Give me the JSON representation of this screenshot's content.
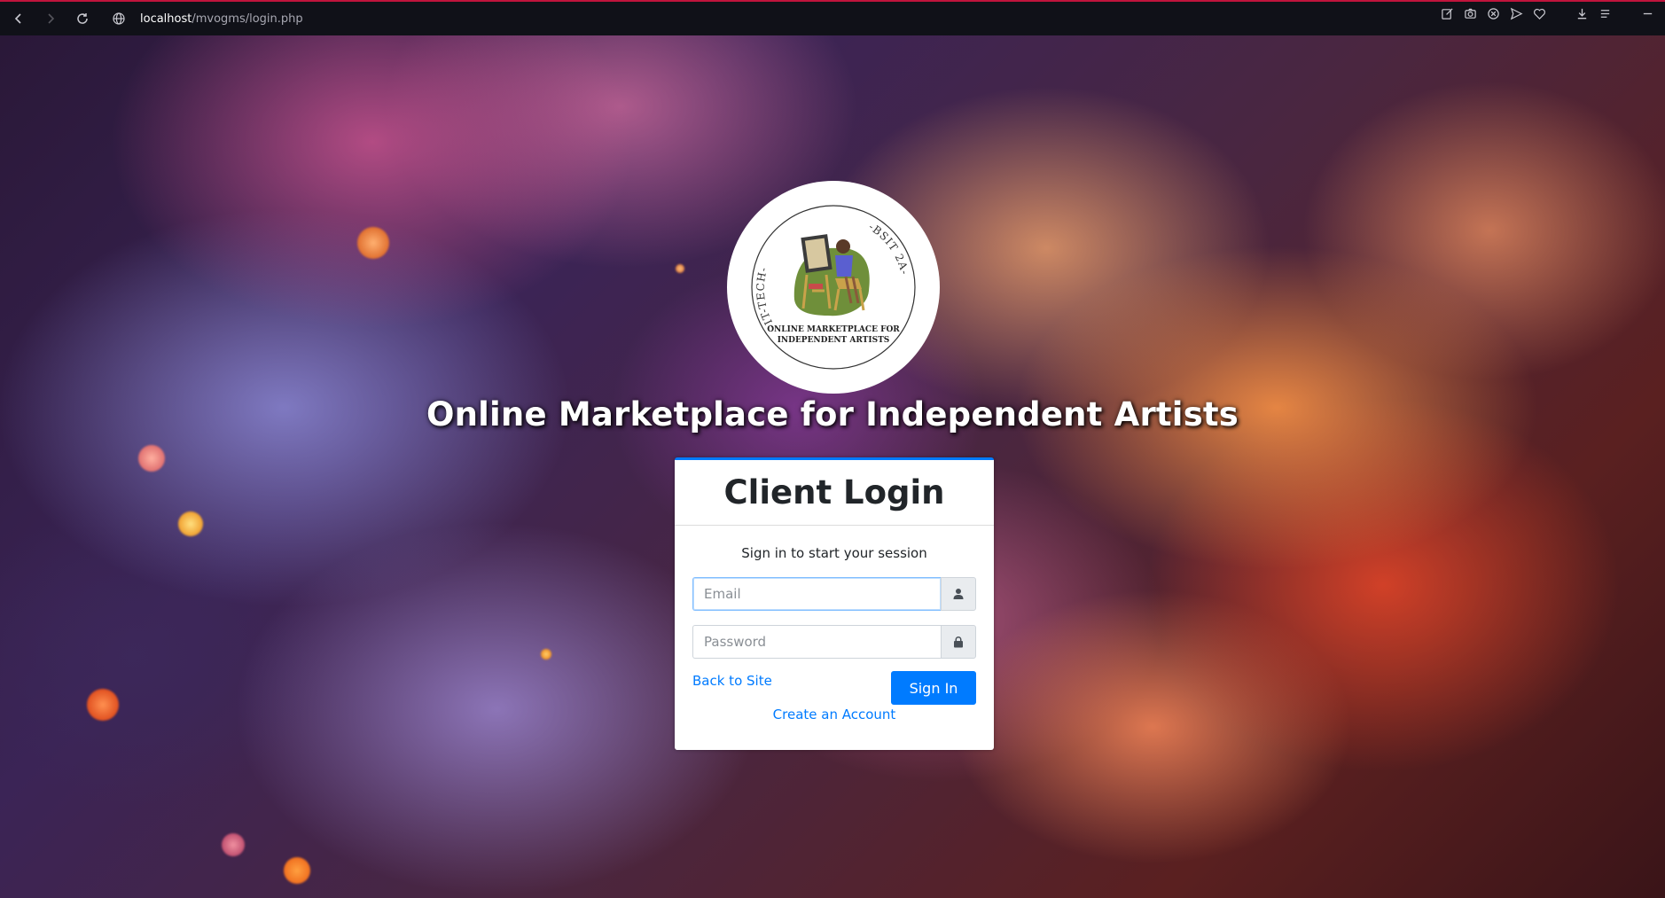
{
  "browser": {
    "url_host": "localhost",
    "url_path": "/mvogms/login.php"
  },
  "logo": {
    "ring_left": "-IT-TECH-",
    "ring_right": "-BSIT 2A-",
    "line1": "ONLINE MARKETPLACE FOR",
    "line2": "INDEPENDENT ARTISTS"
  },
  "site_title": "Online Marketplace for Independent Artists",
  "login": {
    "title": "Client Login",
    "message": "Sign in to start your session",
    "email_placeholder": "Email",
    "email_value": "",
    "password_placeholder": "Password",
    "password_value": "",
    "back_link": "Back to Site",
    "signin_button": "Sign In",
    "create_link": "Create an Account"
  },
  "colors": {
    "primary": "#007bff",
    "browser_accent": "#c0143c"
  },
  "icons": {
    "email_addon": "user-icon",
    "password_addon": "lock-icon"
  }
}
